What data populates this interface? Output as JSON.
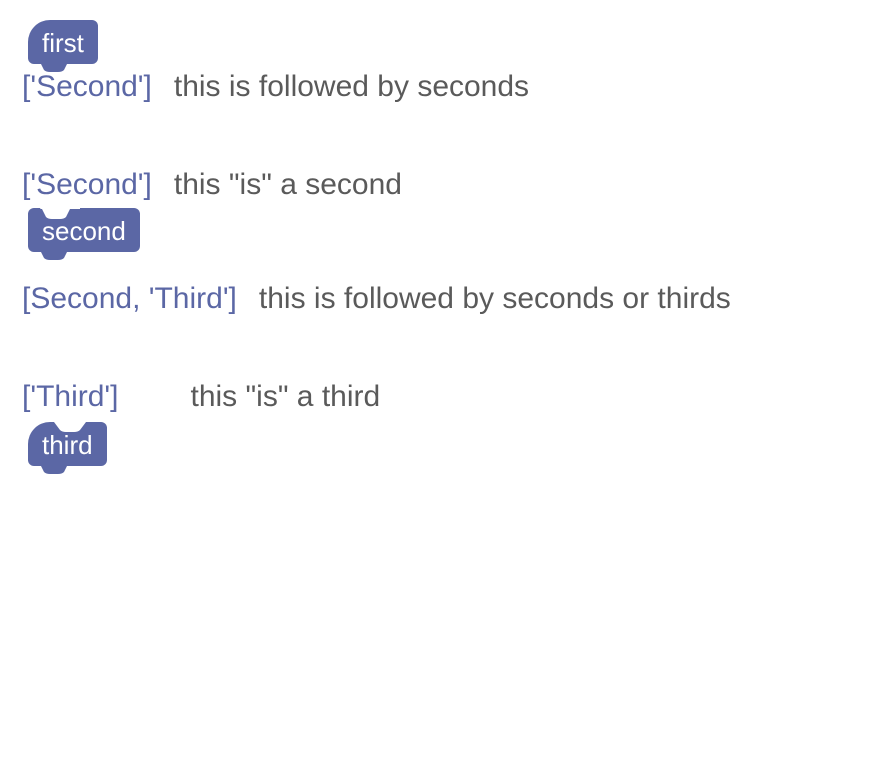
{
  "colors": {
    "block": "#5b67a5",
    "label": "#5b67a5",
    "desc": "#5a5a5a"
  },
  "entries": [
    {
      "block": {
        "kind": "hat",
        "text": "first"
      },
      "tag": "['Second']",
      "desc": "this is followed by seconds"
    },
    {
      "tag": "['Second']",
      "desc": "this \"is\" a second",
      "block": {
        "kind": "stmt",
        "text": "second"
      }
    },
    {
      "tag": "[Second, 'Third']",
      "desc": "this is followed by seconds or thirds"
    },
    {
      "tag": "['Third']",
      "desc": "this \"is\" a third",
      "block": {
        "kind": "hat",
        "text": "third"
      }
    }
  ]
}
